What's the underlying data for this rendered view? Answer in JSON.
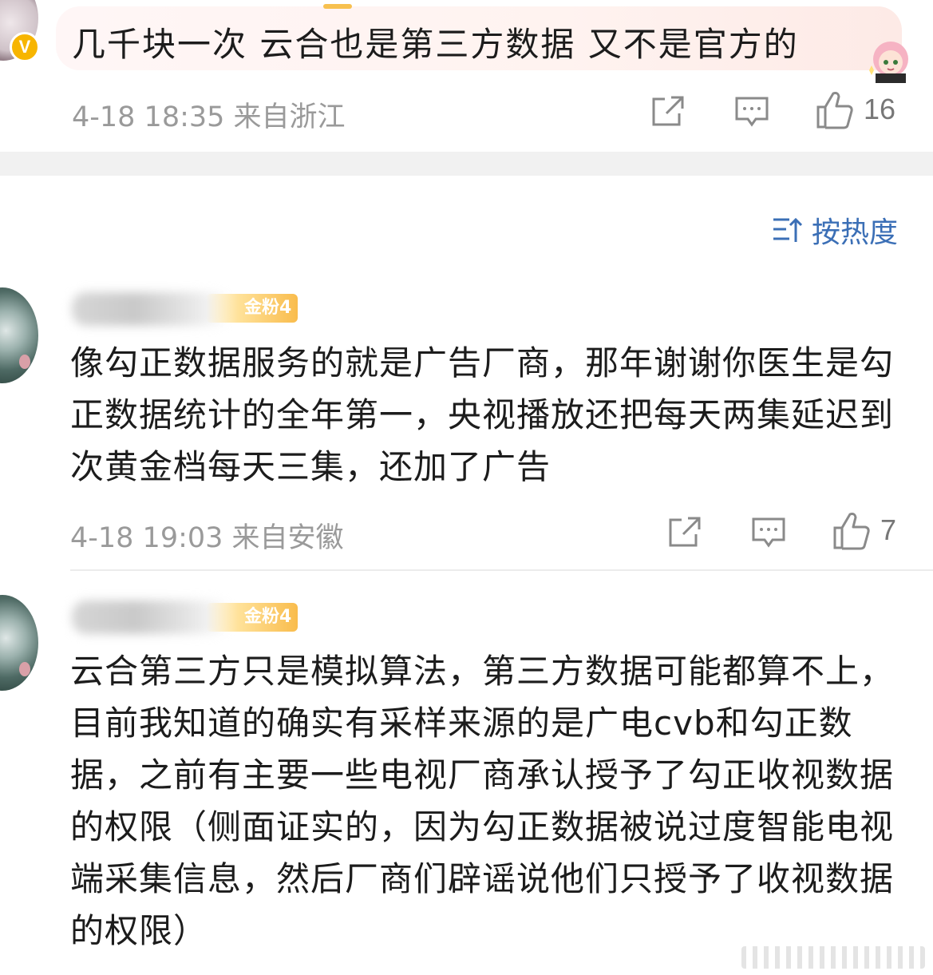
{
  "top_comment": {
    "text": "几千块一次  云合也是第三方数据  又不是官方的",
    "meta": "4-18 18:35  来自浙江",
    "likes": "16",
    "verified_badge": "V"
  },
  "sort": {
    "label": "按热度",
    "icon": "sort-icon"
  },
  "comments": [
    {
      "fan_badge": "金粉4",
      "text": "像勾正数据服务的就是广告厂商，那年谢谢你医生是勾正数据统计的全年第一，央视播放还把每天两集延迟到次黄金档每天三集，还加了广告",
      "meta": "4-18 19:03  来自安徽",
      "likes": "7"
    },
    {
      "fan_badge": "金粉4",
      "text": "云合第三方只是模拟算法，第三方数据可能都算不上，目前我知道的确实有采样来源的是广电cvb和勾正数据，之前有主要一些电视厂商承认授予了勾正收视数据的权限（侧面证实的，因为勾正数据被说过度智能电视端采集信息，然后厂商们辟谣说他们只授予了收视数据的权限）"
    }
  ],
  "colors": {
    "link_blue": "#3b6fb6",
    "meta_gray": "#9a9a9a",
    "badge_gold": "#f9bc4c",
    "verified_gold": "#f7b500"
  }
}
